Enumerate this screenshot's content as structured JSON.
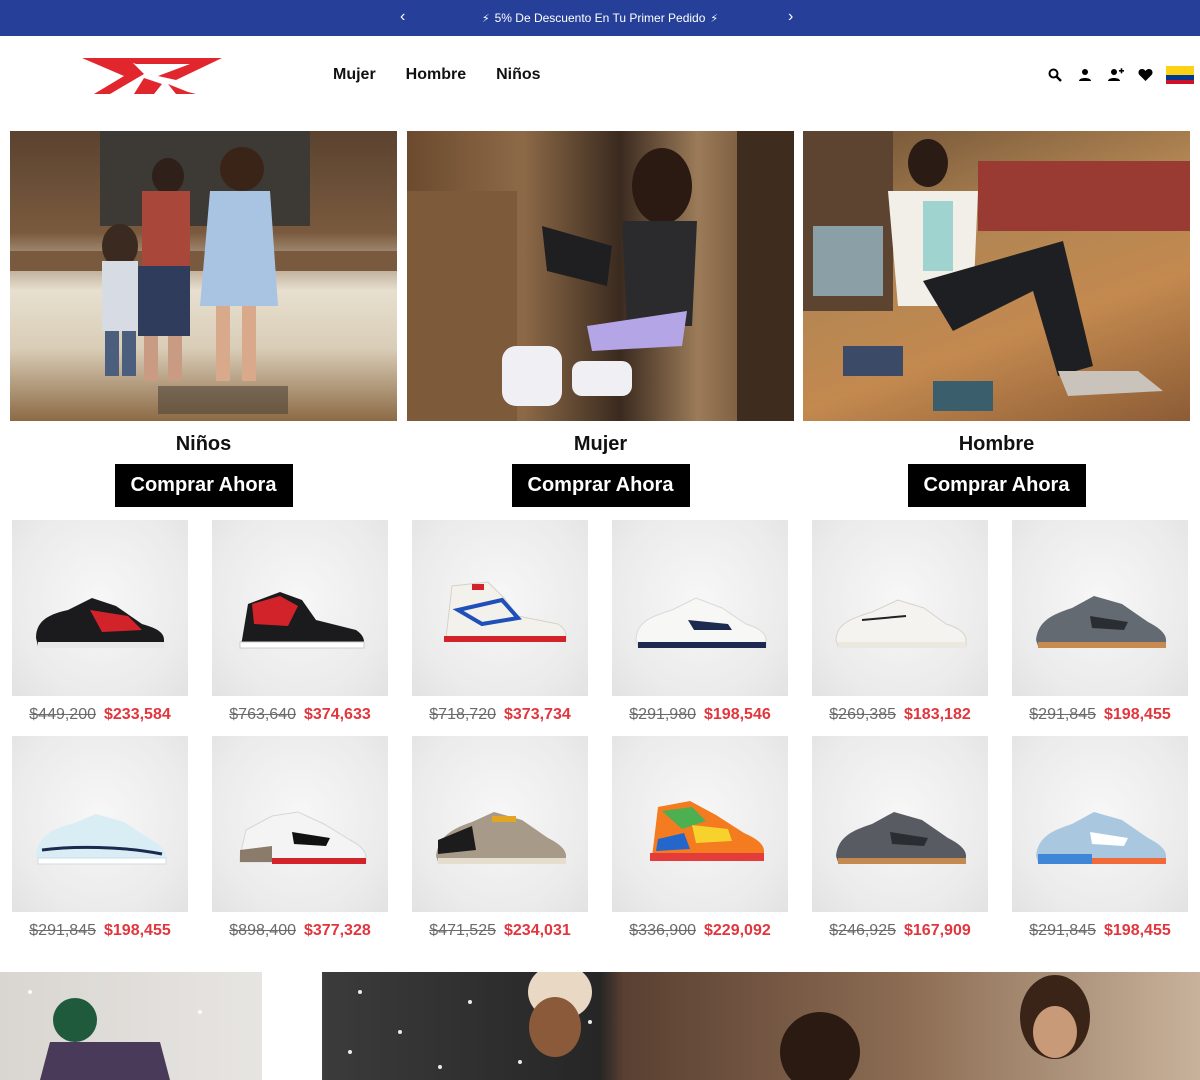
{
  "promo": {
    "message": "5% De Descuento En Tu Primer Pedido",
    "prev": "‹",
    "next": "›",
    "bolt": "⚡"
  },
  "header": {
    "nav": [
      "Mujer",
      "Hombre",
      "Niños"
    ],
    "icons": [
      "search-icon",
      "account-icon",
      "add-user-icon",
      "wishlist-heart-icon",
      "colombia-flag-icon"
    ]
  },
  "categories": [
    {
      "title": "Niños",
      "button": "Comprar Ahora"
    },
    {
      "title": "Mujer",
      "button": "Comprar Ahora"
    },
    {
      "title": "Hombre",
      "button": "Comprar Ahora"
    }
  ],
  "products": [
    {
      "old": "$449,200",
      "new": "$233,584"
    },
    {
      "old": "$763,640",
      "new": "$374,633"
    },
    {
      "old": "$718,720",
      "new": "$373,734"
    },
    {
      "old": "$291,980",
      "new": "$198,546"
    },
    {
      "old": "$269,385",
      "new": "$183,182"
    },
    {
      "old": "$291,845",
      "new": "$198,455"
    },
    {
      "old": "$291,845",
      "new": "$198,455"
    },
    {
      "old": "$898,400",
      "new": "$377,328"
    },
    {
      "old": "$471,525",
      "new": "$234,031"
    },
    {
      "old": "$336,900",
      "new": "$229,092"
    },
    {
      "old": "$246,925",
      "new": "$167,909"
    },
    {
      "old": "$291,845",
      "new": "$198,455"
    }
  ],
  "colors": {
    "promo_bg": "#26409a",
    "brand_red": "#e1262d",
    "sale_price": "#e1363d"
  }
}
